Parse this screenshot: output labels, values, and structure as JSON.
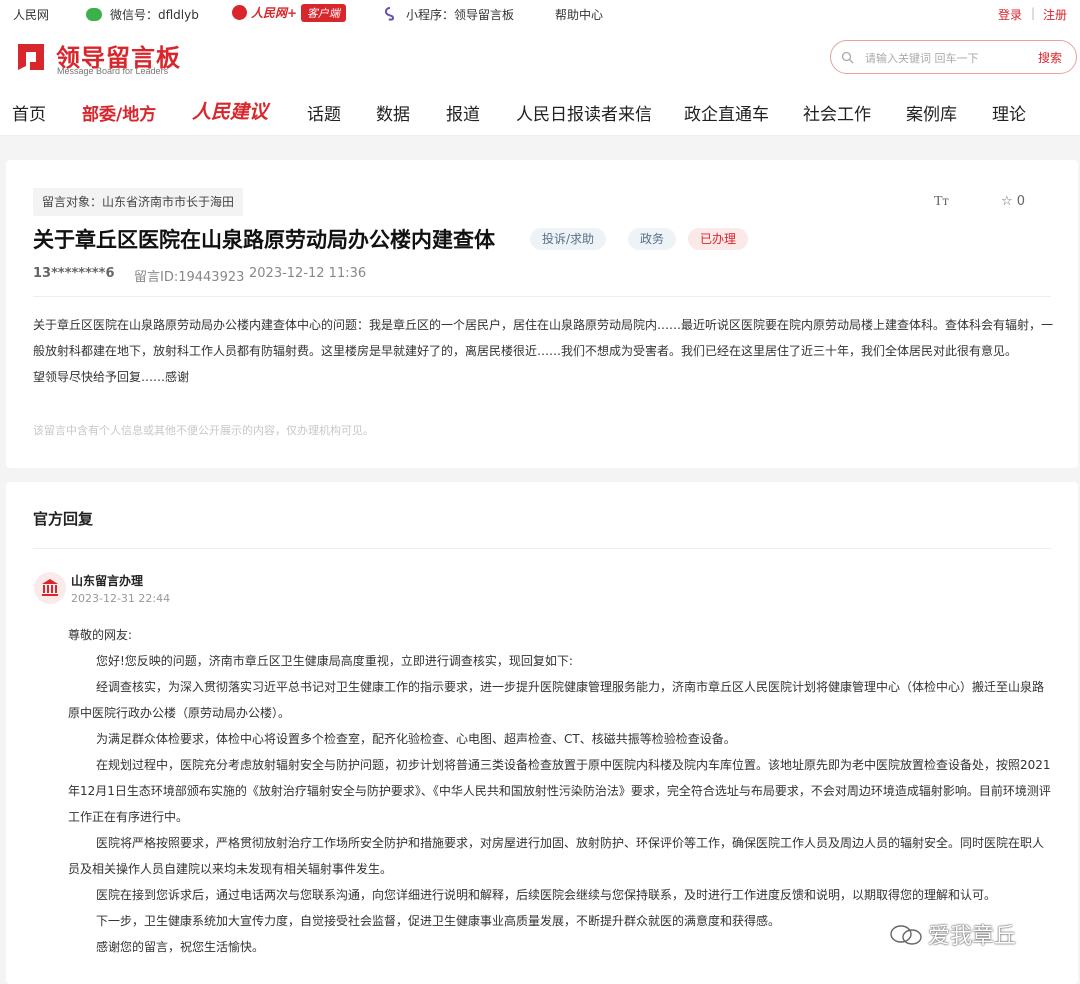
{
  "topbar": {
    "people_net": "人民网",
    "wechat": "微信号：dfldlyb",
    "rmw_plus": "人民网+",
    "client": "客户端",
    "miniprogram": "小程序：领导留言板",
    "help": "帮助中心",
    "login": "登录",
    "sep": "|",
    "register": "注册"
  },
  "header": {
    "logo_title": "领导留言板",
    "logo_sub": "Message Board for Leaders",
    "search_placeholder": "请输入关键词 回车一下",
    "search_button": "搜索"
  },
  "nav": {
    "items": [
      "首页",
      "部委/地方",
      "人民建议",
      "话题",
      "数据",
      "报道",
      "人民日报读者来信",
      "政企直通车",
      "社会工作",
      "案例库",
      "理论"
    ]
  },
  "message": {
    "target": "留言对象：山东省济南市市长于海田",
    "font_toggle": "Tт",
    "favorite_count": "0",
    "title": "关于章丘区医院在山泉路原劳动局办公楼内建查体",
    "tags": [
      "投诉/求助",
      "政务",
      "已办理"
    ],
    "user": "13********6",
    "message_id": "留言ID:19443923",
    "datetime": "2023-12-12 11:36",
    "body": [
      "关于章丘区医院在山泉路原劳动局办公楼内建查体中心的问题：我是章丘区的一个居民户，居住在山泉路原劳动局院内……最近听说区医院要在院内原劳动局楼上建查体科。查体科会有辐射，一般放射科都建在地下，放射科工作人员都有防辐射费。这里楼房是早就建好了的，离居民楼很近……我们不想成为受害者。我们已经在这里居住了近三十年，我们全体居民对此很有意见。",
      "望领导尽快给予回复……感谢"
    ],
    "privacy_tip": "该留言中含有个人信息或其他不便公开展示的内容，仅办理机构可见。"
  },
  "reply": {
    "heading": "官方回复",
    "org": "山东留言办理",
    "datetime": "2023-12-31 22:44",
    "greeting": "尊敬的网友:",
    "paragraphs": [
      "您好!您反映的问题，济南市章丘区卫生健康局高度重视，立即进行调查核实，现回复如下:",
      "经调查核实，为深入贯彻落实习近平总书记对卫生健康工作的指示要求，进一步提升医院健康管理服务能力，济南市章丘区人民医院计划将健康管理中心（体检中心）搬迁至山泉路原中医院行政办公楼（原劳动局办公楼）。",
      "为满足群众体检要求，体检中心将设置多个检查室，配齐化验检查、心电图、超声检查、CT、核磁共振等检验检查设备。",
      "在规划过程中，医院充分考虑放射辐射安全与防护问题，初步计划将普通三类设备检查放置于原中医院内科楼及院内车库位置。该地址原先即为老中医院放置检查设备处，按照2021年12月1日生态环境部颁布实施的《放射治疗辐射安全与防护要求》、《中华人民共和国放射性污染防治法》要求，完全符合选址与布局要求，不会对周边环境造成辐射影响。目前环境测评工作正在有序进行中。",
      "医院将严格按照要求，严格贯彻放射治疗工作场所安全防护和措施要求，对房屋进行加固、放射防护、环保评价等工作，确保医院工作人员及周边人员的辐射安全。同时医院在职人员及相关操作人员自建院以来均未发现有相关辐射事件发生。",
      "医院在接到您诉求后，通过电话两次与您联系沟通，向您详细进行说明和解释，后续医院会继续与您保持联系，及时进行工作进度反馈和说明，以期取得您的理解和认可。",
      "下一步，卫生健康系统加大宣传力度，自觉接受社会监督，促进卫生健康事业高质量发展，不断提升群众就医的满意度和获得感。",
      "感谢您的留言，祝您生活愉快。"
    ]
  },
  "watermark": "爱我章丘",
  "colors": {
    "brand_red": "#d8262c",
    "page_bg": "#f4f4f4",
    "wechat_green": "#3cb04a"
  }
}
